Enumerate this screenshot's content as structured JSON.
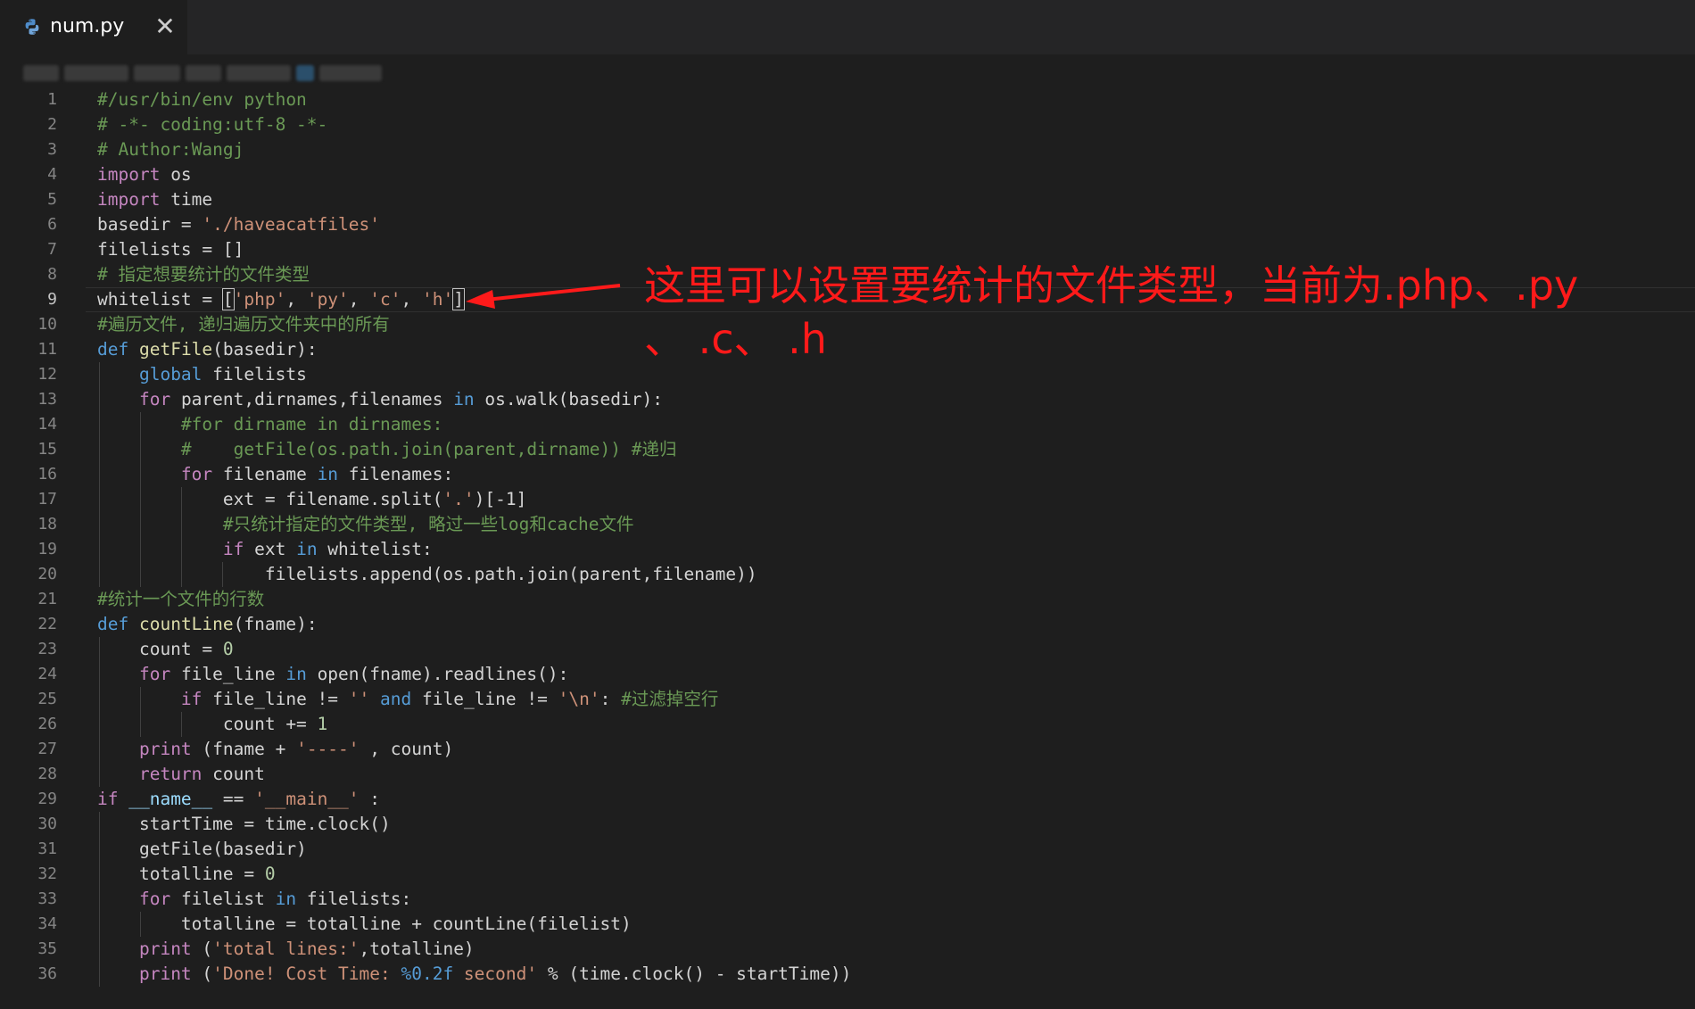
{
  "tab": {
    "title": "num.py",
    "icon": "python-file-icon",
    "close": "✕"
  },
  "active_line": 9,
  "lines": [
    [
      [
        "m",
        "#/usr/bin/env python"
      ]
    ],
    [
      [
        "m",
        "# -*- coding:utf-8 -*-"
      ]
    ],
    [
      [
        "m",
        "# Author:Wangj"
      ]
    ],
    [
      [
        "c",
        "import"
      ],
      [
        "t",
        " os"
      ]
    ],
    [
      [
        "c",
        "import"
      ],
      [
        "t",
        " time"
      ]
    ],
    [
      [
        "t",
        "basedir = "
      ],
      [
        "s",
        "'./haveacatfiles'"
      ]
    ],
    [
      [
        "t",
        "filelists = []"
      ]
    ],
    [
      [
        "m",
        "# 指定想要统计的文件类型"
      ]
    ],
    [
      [
        "t",
        "whitelist = "
      ],
      [
        "br",
        "["
      ],
      [
        "s",
        "'php'"
      ],
      [
        "t",
        ", "
      ],
      [
        "s",
        "'py'"
      ],
      [
        "t",
        ", "
      ],
      [
        "s",
        "'c'"
      ],
      [
        "t",
        ", "
      ],
      [
        "s",
        "'h'"
      ],
      [
        "br",
        "]"
      ]
    ],
    [
      [
        "m",
        "#遍历文件, 递归遍历文件夹中的所有"
      ]
    ],
    [
      [
        "k",
        "def"
      ],
      [
        "t",
        " "
      ],
      [
        "f",
        "getFile"
      ],
      [
        "t",
        "(basedir):"
      ]
    ],
    [
      [
        "t",
        "    "
      ],
      [
        "k",
        "global"
      ],
      [
        "t",
        " filelists"
      ]
    ],
    [
      [
        "t",
        "    "
      ],
      [
        "c",
        "for"
      ],
      [
        "t",
        " parent,dirnames,filenames "
      ],
      [
        "k",
        "in"
      ],
      [
        "t",
        " os.walk(basedir):"
      ]
    ],
    [
      [
        "t",
        "        "
      ],
      [
        "m",
        "#for dirname in dirnames:"
      ]
    ],
    [
      [
        "t",
        "        "
      ],
      [
        "m",
        "#    getFile(os.path.join(parent,dirname)) #递归"
      ]
    ],
    [
      [
        "t",
        "        "
      ],
      [
        "c",
        "for"
      ],
      [
        "t",
        " filename "
      ],
      [
        "k",
        "in"
      ],
      [
        "t",
        " filenames:"
      ]
    ],
    [
      [
        "t",
        "            ext = filename.split("
      ],
      [
        "s",
        "'.'"
      ],
      [
        "t",
        ")[-1]"
      ]
    ],
    [
      [
        "t",
        "            "
      ],
      [
        "m",
        "#只统计指定的文件类型, 略过一些log和cache文件"
      ]
    ],
    [
      [
        "t",
        "            "
      ],
      [
        "c",
        "if"
      ],
      [
        "t",
        " ext "
      ],
      [
        "k",
        "in"
      ],
      [
        "t",
        " whitelist:"
      ]
    ],
    [
      [
        "t",
        "                filelists.append(os.path.join(parent,filename))"
      ]
    ],
    [
      [
        "m",
        "#统计一个文件的行数"
      ]
    ],
    [
      [
        "k",
        "def"
      ],
      [
        "t",
        " "
      ],
      [
        "f",
        "countLine"
      ],
      [
        "t",
        "(fname):"
      ]
    ],
    [
      [
        "t",
        "    count = "
      ],
      [
        "n",
        "0"
      ]
    ],
    [
      [
        "t",
        "    "
      ],
      [
        "c",
        "for"
      ],
      [
        "t",
        " file_line "
      ],
      [
        "k",
        "in"
      ],
      [
        "t",
        " open(fname).readlines():"
      ]
    ],
    [
      [
        "t",
        "        "
      ],
      [
        "c",
        "if"
      ],
      [
        "t",
        " file_line != "
      ],
      [
        "s",
        "''"
      ],
      [
        "t",
        " "
      ],
      [
        "k",
        "and"
      ],
      [
        "t",
        " file_line != "
      ],
      [
        "s",
        "'\\n'"
      ],
      [
        "t",
        ": "
      ],
      [
        "m",
        "#过滤掉空行"
      ]
    ],
    [
      [
        "t",
        "            count += "
      ],
      [
        "n",
        "1"
      ]
    ],
    [
      [
        "t",
        "    "
      ],
      [
        "c",
        "print"
      ],
      [
        "t",
        " (fname + "
      ],
      [
        "s",
        "'----'"
      ],
      [
        "t",
        " , count)"
      ]
    ],
    [
      [
        "t",
        "    "
      ],
      [
        "c",
        "return"
      ],
      [
        "t",
        " count"
      ]
    ],
    [
      [
        "c",
        "if"
      ],
      [
        "t",
        " "
      ],
      [
        "v",
        "__name__"
      ],
      [
        "t",
        " == "
      ],
      [
        "s",
        "'__main__'"
      ],
      [
        "t",
        " :"
      ]
    ],
    [
      [
        "t",
        "    startTime = time.clock()"
      ]
    ],
    [
      [
        "t",
        "    getFile(basedir)"
      ]
    ],
    [
      [
        "t",
        "    totalline = "
      ],
      [
        "n",
        "0"
      ]
    ],
    [
      [
        "t",
        "    "
      ],
      [
        "c",
        "for"
      ],
      [
        "t",
        " filelist "
      ],
      [
        "k",
        "in"
      ],
      [
        "t",
        " filelists:"
      ]
    ],
    [
      [
        "t",
        "        totalline = totalline + countLine(filelist)"
      ]
    ],
    [
      [
        "t",
        "    "
      ],
      [
        "c",
        "print"
      ],
      [
        "t",
        " ("
      ],
      [
        "s",
        "'total lines:'"
      ],
      [
        "t",
        ",totalline)"
      ]
    ],
    [
      [
        "t",
        "    "
      ],
      [
        "c",
        "print"
      ],
      [
        "t",
        " ("
      ],
      [
        "s",
        "'Done! Cost Time: "
      ],
      [
        "k",
        "%0.2f"
      ],
      [
        "s",
        " second'"
      ],
      [
        "t",
        " % (time.clock() - startTime))"
      ]
    ]
  ],
  "annotation": {
    "line1": "这里可以设置要统计的文件类型，当前为.php、.py",
    "line2": "、 .c、 .h",
    "color": "#ff1a1a"
  },
  "colors": {
    "background": "#1e1e1e",
    "tabbar": "#252526",
    "keyword": "#569cd6",
    "control": "#c586c0",
    "string": "#ce9178",
    "comment": "#6a9955",
    "function": "#dcdcaa",
    "number": "#b5cea8"
  }
}
